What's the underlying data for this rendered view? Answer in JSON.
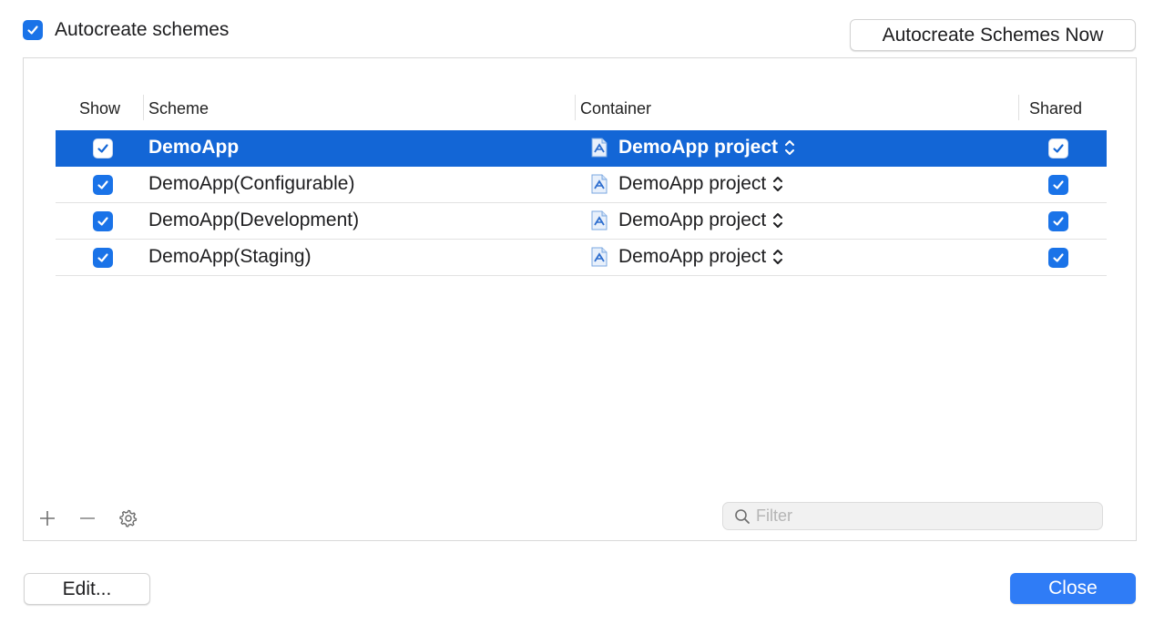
{
  "autocreate": {
    "label": "Autocreate schemes",
    "checked": true,
    "now_button": "Autocreate Schemes Now"
  },
  "table": {
    "headers": {
      "show": "Show",
      "scheme": "Scheme",
      "container": "Container",
      "shared": "Shared"
    },
    "rows": [
      {
        "show": true,
        "scheme": "DemoApp",
        "container": "DemoApp project",
        "shared": true,
        "selected": true
      },
      {
        "show": true,
        "scheme": "DemoApp(Configurable)",
        "container": "DemoApp project",
        "shared": true,
        "selected": false
      },
      {
        "show": true,
        "scheme": "DemoApp(Development)",
        "container": "DemoApp project",
        "shared": true,
        "selected": false
      },
      {
        "show": true,
        "scheme": "DemoApp(Staging)",
        "container": "DemoApp project",
        "shared": true,
        "selected": false
      }
    ]
  },
  "toolbar": {
    "add_icon": "plus-icon",
    "remove_icon": "minus-icon",
    "settings_icon": "gear-icon"
  },
  "filter": {
    "placeholder": "Filter",
    "value": "",
    "icon": "search-icon"
  },
  "footer": {
    "edit_label": "Edit...",
    "close_label": "Close"
  },
  "colors": {
    "accent": "#1a73e8",
    "selection": "#1366d6",
    "primary_button": "#2f7cf6"
  }
}
